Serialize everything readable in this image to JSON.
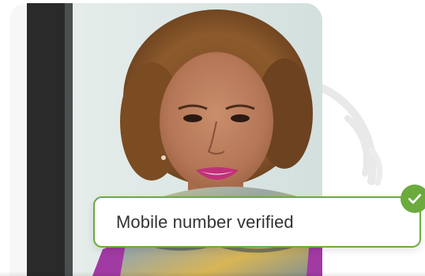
{
  "verification": {
    "message": "Mobile number verified",
    "status": "verified",
    "accent_color": "#6bab3e"
  },
  "photo": {
    "subject": "portrait-woman-curly-hair"
  },
  "icons": {
    "badge": "checkmark-icon"
  }
}
